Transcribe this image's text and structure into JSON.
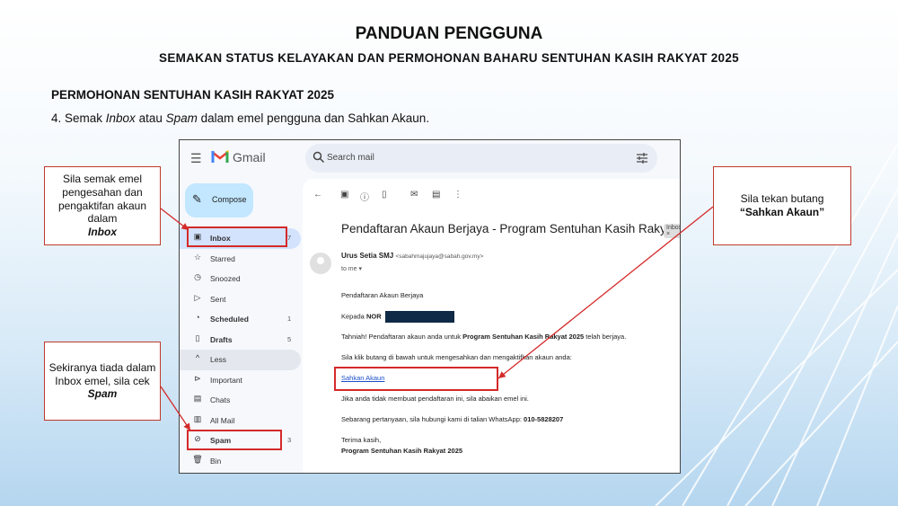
{
  "header": {
    "title": "PANDUAN PENGGUNA",
    "subtitle": "SEMAKAN STATUS KELAYAKAN DAN PERMOHONAN BAHARU SENTUHAN  KASIH RAKYAT 2025"
  },
  "section": "PERMOHONAN SENTUHAN  KASIH RAKYAT 2025",
  "step": {
    "prefix": "4. Semak ",
    "inbox": "Inbox",
    "mid": " atau ",
    "spam": "Spam",
    "suffix": " dalam emel pengguna dan Sahkan Akaun."
  },
  "gmail": {
    "app_name": "Gmail",
    "search_placeholder": "Search mail",
    "compose_label": "Compose",
    "nav": [
      {
        "label": "Inbox",
        "count": "7",
        "icon": "inbox-icon",
        "bold": true,
        "active": true
      },
      {
        "label": "Starred",
        "count": "",
        "icon": "star-icon",
        "bold": false
      },
      {
        "label": "Snoozed",
        "count": "",
        "icon": "clock-icon",
        "bold": false
      },
      {
        "label": "Sent",
        "count": "",
        "icon": "send-icon",
        "bold": false
      },
      {
        "label": "Scheduled",
        "count": "1",
        "icon": "scheduled-icon",
        "bold": true
      },
      {
        "label": "Drafts",
        "count": "5",
        "icon": "draft-icon",
        "bold": true
      },
      {
        "label": "Less",
        "count": "",
        "icon": "chevron-up-icon",
        "bold": false
      },
      {
        "label": "Important",
        "count": "",
        "icon": "important-icon",
        "bold": false
      },
      {
        "label": "Chats",
        "count": "",
        "icon": "chat-icon",
        "bold": false
      },
      {
        "label": "All Mail",
        "count": "",
        "icon": "all-mail-icon",
        "bold": false
      },
      {
        "label": "Spam",
        "count": "3",
        "icon": "spam-icon",
        "bold": true
      },
      {
        "label": "Bin",
        "count": "",
        "icon": "bin-icon",
        "bold": false
      }
    ],
    "email": {
      "subject": "Pendaftaran Akaun Berjaya - Program Sentuhan Kasih Rakyat 2025",
      "label_badge": "Inbox ×",
      "sender_name": "Urus Setia SMJ",
      "sender_email": "<sabahmajujaya@sabah.gov.my>",
      "to": "to me",
      "body": {
        "l1": "Pendaftaran Akaun Berjaya",
        "l2_prefix": "Kepada ",
        "l2_name": "NOR",
        "l3_prefix": "Tahniah! Pendaftaran akaun anda untuk ",
        "l3_bold": "Program Sentuhan Kasih Rakyat 2025",
        "l3_suffix": " telah berjaya.",
        "l4": "Sila klik butang di bawah untuk mengesahkan dan mengaktifkan akaun anda:",
        "l5_link": "Sahkan Akaun",
        "l6": "Jika anda tidak membuat pendaftaran ini, sila abaikan emel ini.",
        "l7_prefix": "Sebarang pertanyaan, sila hubungi kami di talian WhatsApp: ",
        "l7_bold": "010-5828207",
        "l8": "Terima kasih,",
        "l9": "Program Sentuhan Kasih Rakyat 2025"
      }
    }
  },
  "callouts": {
    "inbox": {
      "text": "Sila semak emel pengesahan dan pengaktifan akaun dalam",
      "bold": "Inbox"
    },
    "spam": {
      "text": "Sekiranya tiada dalam Inbox emel, sila cek",
      "bold": "Spam"
    },
    "sahkan": {
      "text": "Sila tekan butang",
      "bold": "“Sahkan Akaun”"
    }
  },
  "colors": {
    "callout_border": "#c0392b",
    "highlight_red": "#d42a2a",
    "compose_bg": "#c2e7ff",
    "inbox_active_bg": "#d3e3fd",
    "link": "#1a4fcb"
  }
}
